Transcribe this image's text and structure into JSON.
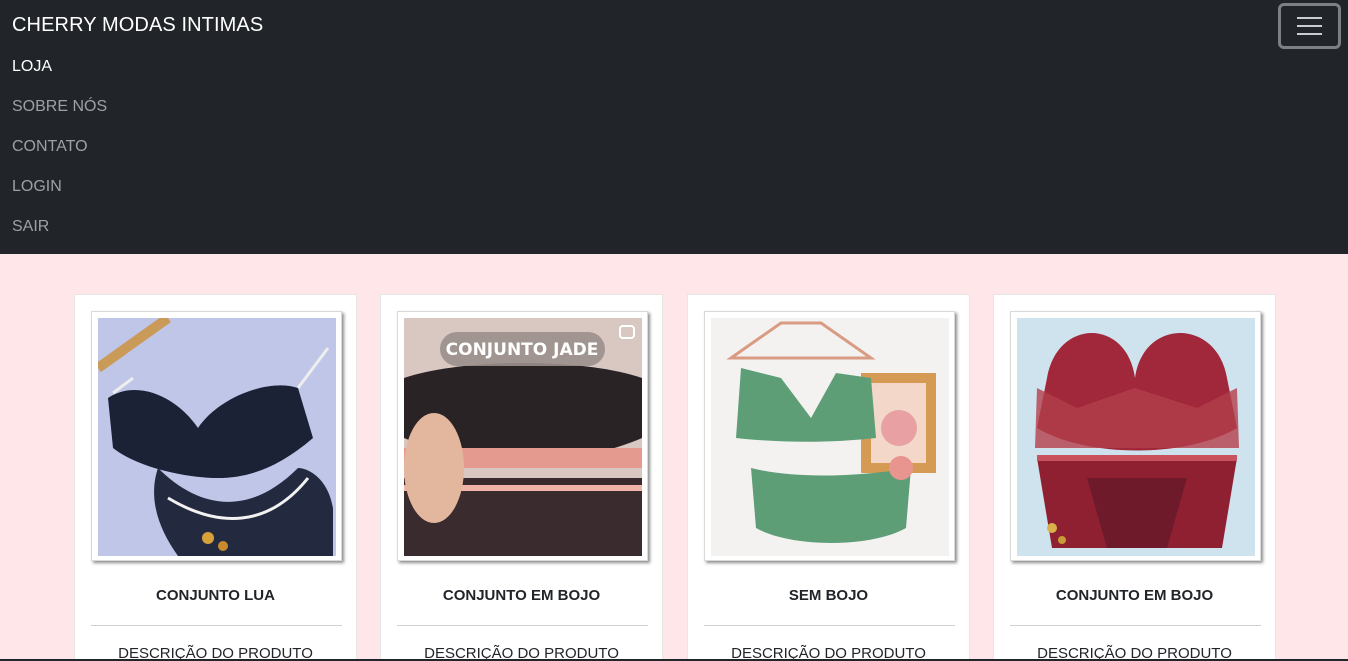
{
  "navbar": {
    "brand": "CHERRY MODAS INTIMAS",
    "toggler_icon": "hamburger-menu-icon",
    "items": [
      {
        "label": "LOJA",
        "active": true
      },
      {
        "label": "SOBRE NÓS",
        "active": false
      },
      {
        "label": "CONTATO",
        "active": false
      },
      {
        "label": "LOGIN",
        "active": false
      },
      {
        "label": "SAIR",
        "active": false
      }
    ]
  },
  "products": [
    {
      "title": "CONJUNTO LUA",
      "description": "DESCRIÇÃO DO PRODUTO",
      "image": "black-lace-lingerie-photo"
    },
    {
      "title": "CONJUNTO EM BOJO",
      "description": "DESCRIÇÃO DO PRODUTO",
      "image": "black-pink-lace-lingerie-photo",
      "overlay_text": "CONJUNTO JADE"
    },
    {
      "title": "SEM BOJO",
      "description": "DESCRIÇÃO DO PRODUTO",
      "image": "green-lace-lingerie-photo"
    },
    {
      "title": "CONJUNTO EM BOJO",
      "description": "DESCRIÇÃO DO PRODUTO",
      "image": "red-lingerie-photo"
    }
  ],
  "colors": {
    "navbar_bg": "#212529",
    "page_bg": "#ffe6e8",
    "nav_active": "#ffffff",
    "nav_muted": "#9ea1a4"
  }
}
